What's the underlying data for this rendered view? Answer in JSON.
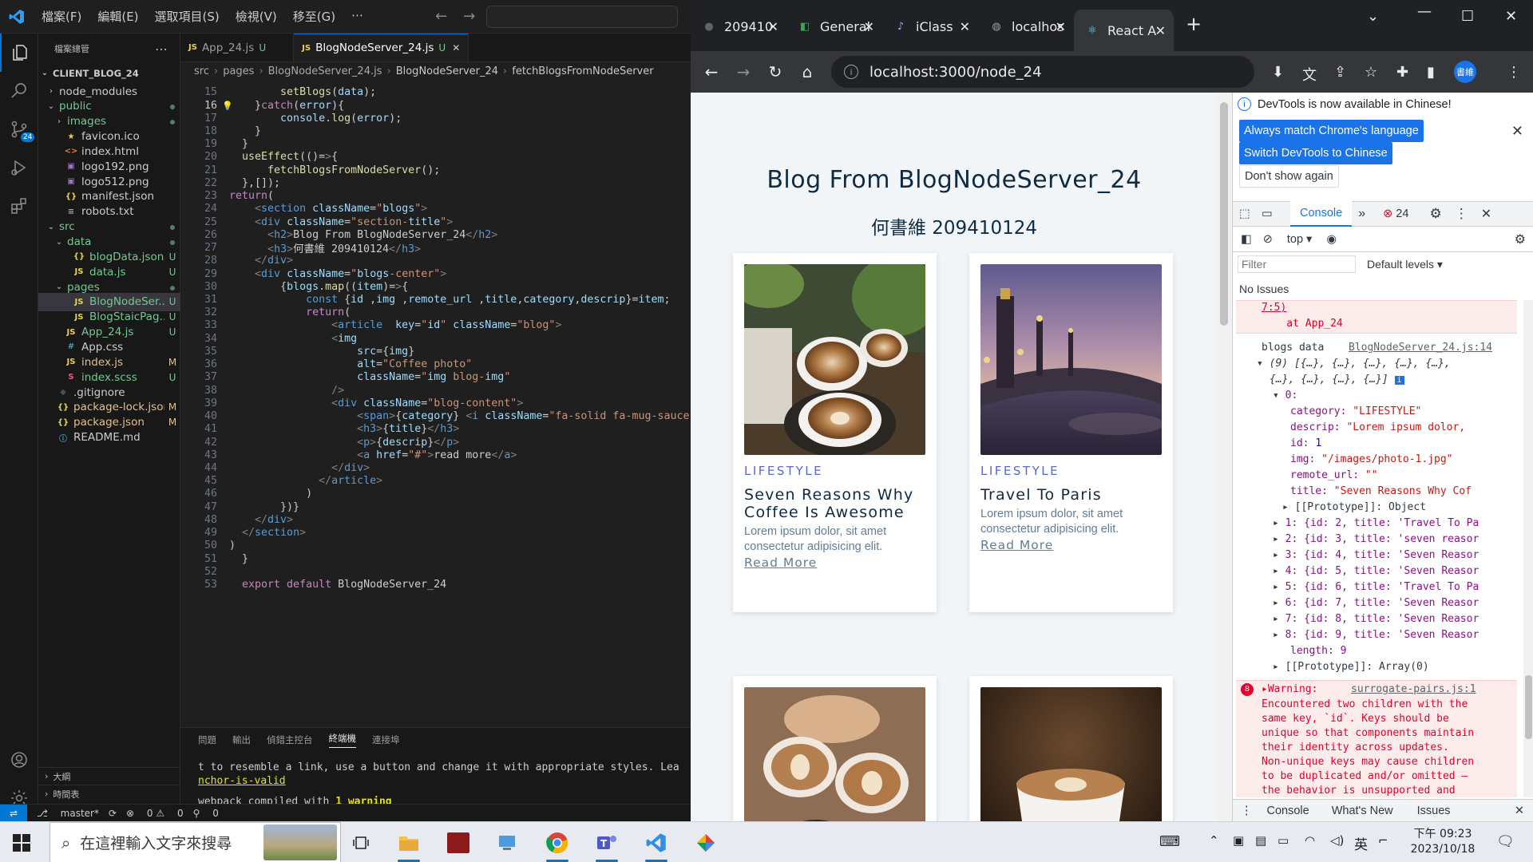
{
  "vscode": {
    "menu": [
      "檔案(F)",
      "編輯(E)",
      "選取項目(S)",
      "檢視(V)",
      "移至(G)",
      "⋯"
    ],
    "explorer_title": "檔案總管",
    "project": "CLIENT_BLOG_24",
    "source_control_badge": "24",
    "tree": [
      {
        "label": "node_modules",
        "type": "folder",
        "depth": 1,
        "open": false,
        "status": ""
      },
      {
        "label": "public",
        "type": "folder",
        "depth": 1,
        "open": true,
        "status": "dot",
        "color": "#73c991"
      },
      {
        "label": "images",
        "type": "folder",
        "depth": 2,
        "open": false,
        "status": "dot",
        "color": "#73c991"
      },
      {
        "label": "favicon.ico",
        "type": "star",
        "depth": 2,
        "status": ""
      },
      {
        "label": "index.html",
        "type": "html",
        "depth": 2,
        "status": ""
      },
      {
        "label": "logo192.png",
        "type": "img",
        "depth": 2,
        "status": ""
      },
      {
        "label": "logo512.png",
        "type": "img",
        "depth": 2,
        "status": ""
      },
      {
        "label": "manifest.json",
        "type": "json",
        "depth": 2,
        "status": ""
      },
      {
        "label": "robots.txt",
        "type": "txt",
        "depth": 2,
        "status": ""
      },
      {
        "label": "src",
        "type": "folder",
        "depth": 1,
        "open": true,
        "status": "dot",
        "color": "#73c991"
      },
      {
        "label": "data",
        "type": "folder",
        "depth": 2,
        "open": true,
        "status": "dot",
        "color": "#73c991"
      },
      {
        "label": "blogData.json",
        "type": "json",
        "depth": 3,
        "status": "U",
        "color": "#73c991"
      },
      {
        "label": "data.js",
        "type": "js",
        "depth": 3,
        "status": "U",
        "color": "#73c991"
      },
      {
        "label": "pages",
        "type": "folder",
        "depth": 2,
        "open": true,
        "status": "dot",
        "color": "#73c991"
      },
      {
        "label": "BlogNodeSer...",
        "type": "js",
        "depth": 3,
        "status": "U",
        "color": "#73c991",
        "selected": true
      },
      {
        "label": "BlogStaicPag...",
        "type": "js",
        "depth": 3,
        "status": "U",
        "color": "#73c991"
      },
      {
        "label": "App_24.js",
        "type": "js",
        "depth": 2,
        "status": "U",
        "color": "#73c991"
      },
      {
        "label": "App.css",
        "type": "css",
        "depth": 2,
        "status": ""
      },
      {
        "label": "index.js",
        "type": "js",
        "depth": 2,
        "status": "M",
        "color": "#e2c08d"
      },
      {
        "label": "index.scss",
        "type": "scss",
        "depth": 2,
        "status": "U",
        "color": "#73c991"
      },
      {
        "label": ".gitignore",
        "type": "git",
        "depth": 1,
        "status": ""
      },
      {
        "label": "package-lock.json",
        "type": "json",
        "depth": 1,
        "status": "M",
        "color": "#e2c08d"
      },
      {
        "label": "package.json",
        "type": "json",
        "depth": 1,
        "status": "M",
        "color": "#e2c08d"
      },
      {
        "label": "README.md",
        "type": "info",
        "depth": 1,
        "status": ""
      }
    ],
    "outline_label": "大綱",
    "timeline_label": "時間表",
    "tabs": [
      {
        "label": "App_24.js",
        "status": "U",
        "active": false
      },
      {
        "label": "BlogNodeServer_24.js",
        "status": "U",
        "active": true
      }
    ],
    "breadcrumbs": [
      "src",
      "pages",
      "BlogNodeServer_24.js",
      "BlogNodeServer_24",
      "fetchBlogsFromNodeServer"
    ],
    "first_line": 15,
    "current_line": 16,
    "code": [
      "        setBlogs(data);",
      "    }catch(error){",
      "        console.log(error);",
      "    }",
      "  }",
      "  useEffect(()=>{",
      "      fetchBlogsFromNodeServer();",
      "  },[]);",
      "return(",
      "    <section className=\"blogs\">",
      "    <div className=\"section-title\">",
      "      <h2>Blog From BlogNodeServer_24</h2>",
      "      <h3>何書維 209410124</h3>",
      "    </div>",
      "    <div className=\"blogs-center\">",
      "        {blogs.map((item)=>{",
      "            const {id ,img ,remote_url ,title,category,descrip}=item;",
      "            return(",
      "                <article  key=\"id\" className=\"blog\">",
      "                <img",
      "                    src={img}",
      "                    alt=\"Coffee photo\"",
      "                    className=\"img blog-img\"",
      "                />",
      "                <div className=\"blog-content\">",
      "                    <span>{category} <i className=\"fa-solid fa-mug-saucer\"",
      "                    <h3>{title}</h3>",
      "                    <p>{descrip}</p>",
      "                    <a href=\"#\">read more</a>",
      "                </div>",
      "              </article>",
      "            )",
      "        })}",
      "    </div>",
      "  </section>",
      ")",
      "  }",
      "",
      "  export default BlogNodeServer_24"
    ],
    "panel_tabs": [
      "問題",
      "輸出",
      "偵錯主控台",
      "終端機",
      "連接埠"
    ],
    "active_panel_tab": "終端機",
    "terminal": {
      "line1": "t to resemble a link, use a button and change it with appropriate styles. Lea",
      "line2": "nchor-is-valid",
      "line3": "webpack compiled with ",
      "line3_bold": "1 warning"
    },
    "status": {
      "branch": "master*",
      "errors": "0",
      "warnings": "0",
      "ports": "0"
    }
  },
  "chrome": {
    "tabs": [
      {
        "label": "209410",
        "active": false
      },
      {
        "label": "General",
        "active": false
      },
      {
        "label": "iClass",
        "active": false
      },
      {
        "label": "localhos",
        "active": false
      },
      {
        "label": "React A",
        "active": true
      }
    ],
    "url": "localhost:3000/node_24",
    "profile_label": "書維",
    "page": {
      "title": "Blog From BlogNodeServer_24",
      "subtitle": "何書維 209410124",
      "cards": [
        {
          "category": "LIFESTYLE",
          "title": "Seven Reasons Why Coffee Is Awesome",
          "descrip": "Lorem ipsum dolor, sit amet consectetur adipisicing elit.",
          "link": "Read More"
        },
        {
          "category": "LIFESTYLE",
          "title": "Travel To Paris",
          "descrip": "Lorem ipsum dolor, sit amet consectetur adipisicing elit.",
          "link": "Read More"
        }
      ]
    },
    "devtools": {
      "info": "DevTools is now available in Chinese!",
      "btn_match": "Always match Chrome's language",
      "btn_switch": "Switch DevTools to Chinese",
      "btn_dont": "Don't show again",
      "tab_console": "Console",
      "error_count": "24",
      "context": "top",
      "filter_placeholder": "Filter",
      "levels": "Default levels ▾",
      "no_issues": "No Issues",
      "console_lines": {
        "err_tail1": "7:5)",
        "err_tail2": "    at App_24",
        "log_label": "blogs data ",
        "log_link": "BlogNodeServer_24.js:14",
        "arr1": "(9) [{…}, {…}, {…}, {…}, {…},",
        "arr2": "{…}, {…}, {…}, {…}]",
        "idx0": "0:",
        "category": "\"LIFESTYLE\"",
        "descrip": "\"Lorem ipsum dolor,",
        "id": "1",
        "img": "\"/images/photo-1.jpg\"",
        "remote_url": "\"\"",
        "title": "\"Seven Reasons Why Cof",
        "proto_obj": "[[Prototype]]: Object",
        "items": [
          "1: {id: 2, title: 'Travel To Pa",
          "2: {id: 3, title: 'seven reasor",
          "3: {id: 4, title: 'Seven Reasor",
          "4: {id: 5, title: 'Seven Reasor",
          "5: {id: 6, title: 'Travel To Pa",
          "6: {id: 7, title: 'Seven Reasor",
          "7: {id: 8, title: 'Seven Reasor",
          "8: {id: 9, title: 'Seven Reasor"
        ],
        "length": "length: 9",
        "proto_arr": "[[Prototype]]: Array(0)",
        "warn_count": "8",
        "warn_label": "Warning: ",
        "warn_link": "surrogate-pairs.js:1",
        "warn_lines": [
          "Encountered two children with the",
          "same key, `id`. Keys should be",
          "unique so that components maintain",
          "their identity across updates.",
          "Non-unique keys may cause children",
          "to be duplicated and/or omitted —",
          "the behavior is unsupported and"
        ]
      },
      "drawer_tabs": [
        "Console",
        "What's New",
        "Issues"
      ]
    }
  },
  "taskbar": {
    "search_placeholder": "在這裡輸入文字來搜尋",
    "lang": "英",
    "time": "下午 09:23",
    "date": "2023/10/18"
  }
}
